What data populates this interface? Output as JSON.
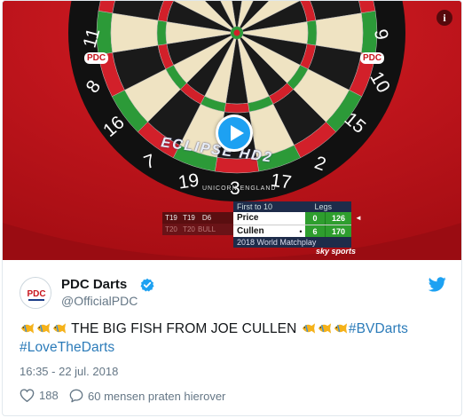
{
  "media": {
    "board_numbers": [
      "11",
      "8",
      "16",
      "7",
      "19",
      "3",
      "17",
      "2",
      "15",
      "10",
      "9"
    ],
    "board_brand": "ECLIPSE HD2",
    "board_sub": "UNICORN ENGLAND",
    "pdc_badge": "PDC",
    "info_label": "i",
    "throws": {
      "row1": [
        "T19",
        "T19",
        "D6"
      ],
      "row2": [
        "T20",
        "T20",
        "BULL"
      ]
    },
    "scoreboard": {
      "header_left": "First to 10",
      "header_right": "Legs",
      "players": [
        {
          "name": "Price",
          "marker": "",
          "legs": "0",
          "points": "126"
        },
        {
          "name": "Cullen",
          "marker": "•",
          "legs": "6",
          "points": "170"
        }
      ],
      "event": "2018 World Matchplay",
      "arrow": "◄"
    },
    "broadcaster": "sky sports"
  },
  "author": {
    "display_name": "PDC Darts",
    "handle": "@OfficialPDC",
    "avatar_text": "PDC"
  },
  "tweet": {
    "text_main": "THE BIG FISH FROM JOE CULLEN",
    "hashtag1": "#BVDarts",
    "hashtag2": "#LoveTheDarts",
    "timestamp": "16:35 - 22 jul. 2018"
  },
  "actions": {
    "likes": "188",
    "replies_text": "60 mensen praten hierover"
  },
  "colors": {
    "link": "#2b7bb9",
    "verified": "#1da1f2",
    "muted": "#657786",
    "surround_red": "#c7141c"
  }
}
